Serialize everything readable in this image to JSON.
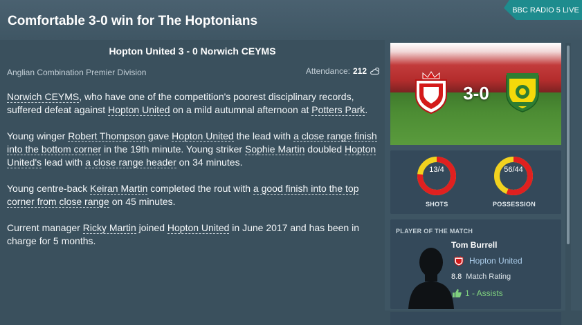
{
  "headline": "Comfortable 3-0 win for The Hoptonians",
  "source": "BBC RADIO 5 LIVE",
  "match_title": "Hopton United 3 - 0 Norwich CEYMS",
  "competition": "Anglian Combination Premier Division",
  "attendance_label": "Attendance:",
  "attendance_value": "212",
  "paragraphs": [
    {
      "l1": "Norwich CEYMS",
      "t1": ", who have one of the competition's poorest disciplinary records, suffered defeat against ",
      "l2": "Hopton United",
      "t2": " on a mild autumnal afternoon at ",
      "l3": "Potters Park",
      "t3": "."
    },
    {
      "t0": "Young winger ",
      "l1": "Robert Thompson",
      "t1": " gave ",
      "l2": "Hopton United",
      "t2": " the lead with ",
      "l3": "a close range finish into the bottom corner",
      "t3": " in the 19th minute. Young striker ",
      "l4": "Sophie Martin",
      "t4": " doubled ",
      "l5": "Hopton United's",
      "t5": " lead with ",
      "l6": "a close range header",
      "t6": " on 34 minutes."
    },
    {
      "t0": "Young centre-back ",
      "l1": "Keiran Martin",
      "t1": " completed the rout with ",
      "l2": "a good finish into the top corner from close range",
      "t2": " on 45 minutes."
    },
    {
      "t0": "Current manager ",
      "l1": "Ricky Martin",
      "t1": " joined ",
      "l2": "Hopton United",
      "t2": " in June 2017 and has been in charge for 5 months."
    }
  ],
  "score": "3-0",
  "stats": {
    "shots_label": "SHOTS",
    "shots_value": "13/4",
    "shots_home_fraction": 0.765,
    "possession_label": "POSSESSION",
    "possession_value": "56/44",
    "possession_home_fraction": 0.56,
    "home_color": "#e02020",
    "away_color": "#f2d21f"
  },
  "potm": {
    "heading": "PLAYER OF THE MATCH",
    "name": "Tom Burrell",
    "club": "Hopton United",
    "rating": "8.8",
    "rating_label": "Match Rating",
    "assists": "1 - Assists"
  },
  "icons": {
    "weather": "cloud-sun-icon",
    "assists": "thumbs-up-icon",
    "home_crest": "hopton-crest-icon",
    "away_crest": "norwich-ceyms-crest-icon"
  }
}
